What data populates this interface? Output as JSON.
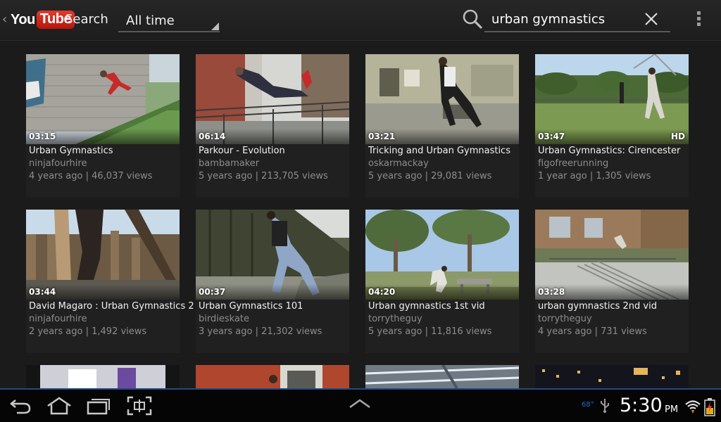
{
  "header": {
    "logo_you": "You",
    "logo_tube": "Tube",
    "title": "Search",
    "filter_value": "All time",
    "search_query": "urban gymnastics"
  },
  "icons": {
    "back": "chevron-left-icon",
    "search": "search-icon",
    "clear": "close-icon",
    "overflow": "overflow-menu-icon"
  },
  "videos": [
    {
      "duration": "03:15",
      "title": "Urban Gymnastics",
      "channel": "ninjafourhire",
      "meta": "4 years ago | 46,037 views",
      "hd": ""
    },
    {
      "duration": "06:14",
      "title": "Parkour - Evolution",
      "channel": "bambamaker",
      "meta": "5 years ago | 213,705 views",
      "hd": ""
    },
    {
      "duration": "03:21",
      "title": "Tricking and Urban Gymnastics",
      "channel": "oskarmackay",
      "meta": "5 years ago | 29,081 views",
      "hd": ""
    },
    {
      "duration": "03:47",
      "title": "Urban Gymnastics: Cirencester",
      "channel": "figofreerunning",
      "meta": "1 year ago | 1,305 views",
      "hd": "HD"
    },
    {
      "duration": "03:44",
      "title": "David Magaro : Urban Gymnastics 2",
      "channel": "ninjafourhire",
      "meta": "2 years ago | 1,492 views",
      "hd": ""
    },
    {
      "duration": "00:37",
      "title": "Urban Gymnastics 101",
      "channel": "birdieskate",
      "meta": "3 years ago | 21,302 views",
      "hd": ""
    },
    {
      "duration": "04:20",
      "title": "Urban gymnastics 1st vid",
      "channel": "torrytheguy",
      "meta": "5 years ago | 11,816 views",
      "hd": ""
    },
    {
      "duration": "03:28",
      "title": "urban gymnastics 2nd vid",
      "channel": "torrytheguy",
      "meta": "4 years ago | 731 views",
      "hd": ""
    }
  ],
  "system_bar": {
    "temperature": "68°",
    "time": "5:30",
    "ampm": "PM"
  },
  "colors": {
    "background": "#1b1b1b",
    "card": "#202020",
    "secondary_text": "#8d8d8d",
    "system_accent": "#1f4d86",
    "youtube_red": "#cc181e"
  }
}
